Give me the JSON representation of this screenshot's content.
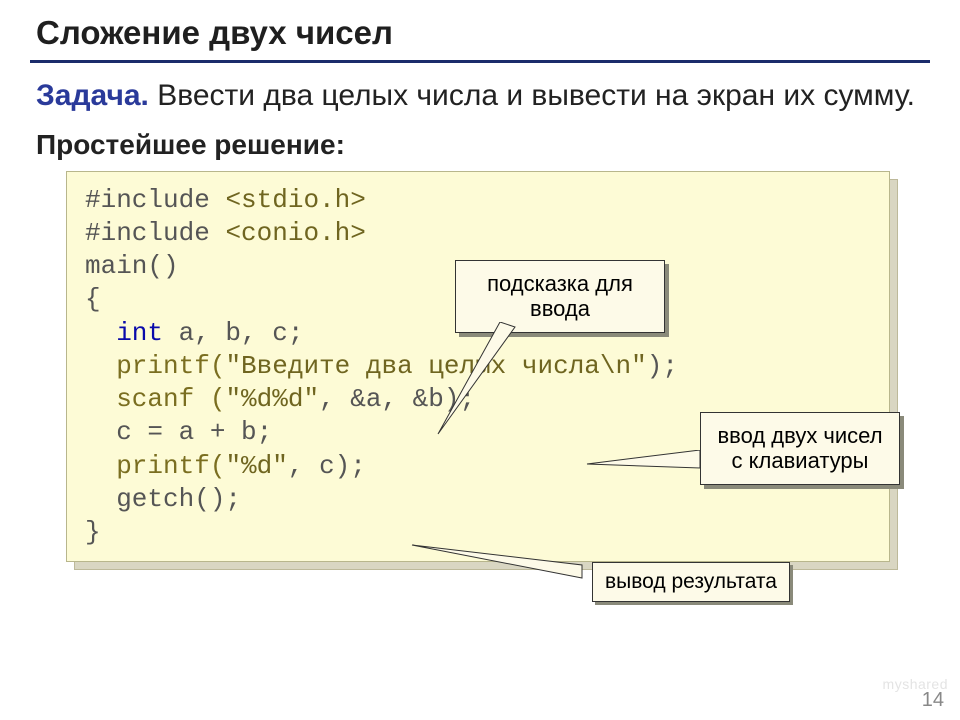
{
  "title": "Сложение двух чисел",
  "task_label": "Задача.",
  "task_text": " Ввести два целых числа и вывести на экран их сумму.",
  "subhead": "Простейшее решение:",
  "code": {
    "l1a": "#include ",
    "l1b": "<stdio.h>",
    "l2a": "#include ",
    "l2b": "<conio.h>",
    "l3": "main()",
    "l4": "{",
    "l5a": "  int",
    "l5b": " a, b, c;",
    "l6a": "  printf(",
    "l6b": "\"Введите два целых числа\\n\"",
    "l6c": ");",
    "l7a": "  scanf (",
    "l7b": "\"%d%d\"",
    "l7c": ", &a, &b);",
    "l8": "  c = a + b;",
    "l9a": "  printf(",
    "l9b": "\"%d\"",
    "l9c": ", c);",
    "l10": "  getch();",
    "l11": "}"
  },
  "callouts": {
    "hint": "подсказка для ввода",
    "input": "ввод двух чисел с клавиатуры",
    "output": "вывод результата"
  },
  "page": "14",
  "watermark": "myshared"
}
